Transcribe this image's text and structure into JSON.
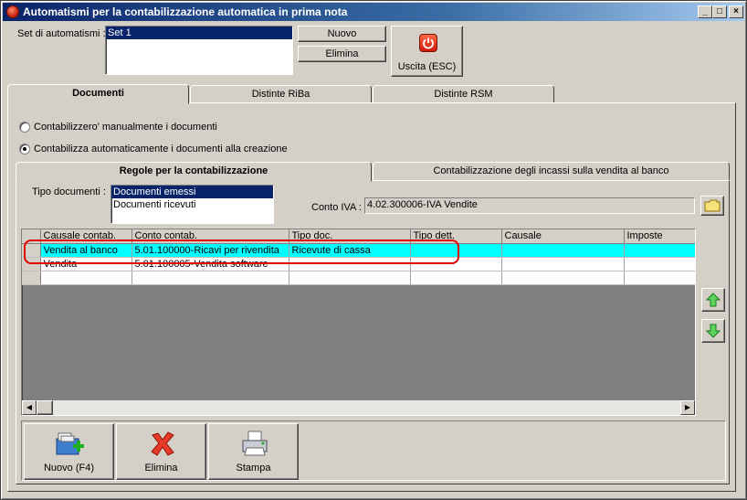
{
  "window": {
    "title": "Automatismi per la contabilizzazione automatica in prima nota",
    "controls": [
      "_",
      "□",
      "×"
    ]
  },
  "top": {
    "set_label": "Set di automatismi :",
    "sets": [
      "Set 1"
    ],
    "nuovo_label": "Nuovo",
    "elimina_label": "Elimina",
    "uscita_label": "Uscita (ESC)"
  },
  "tabs": [
    {
      "label": "Documenti",
      "active": true
    },
    {
      "label": "Distinte RiBa",
      "active": false
    },
    {
      "label": "Distinte RSM",
      "active": false
    }
  ],
  "documenti": {
    "radio_manual": "Contabilizzero' manualmente i documenti",
    "radio_auto": "Contabilizza automaticamente i documenti alla creazione",
    "selected": "auto"
  },
  "subtabs": [
    {
      "label": "Regole per la contabilizzazione",
      "active": true
    },
    {
      "label": "Contabilizzazione degli incassi sulla vendita al banco",
      "active": false
    }
  ],
  "regole": {
    "tipo_documenti_label": "Tipo documenti :",
    "tipo_documenti": [
      "Documenti emessi",
      "Documenti ricevuti"
    ],
    "conto_iva_label": "Conto IVA :",
    "conto_iva_value": "4.02.300006-IVA Vendite"
  },
  "grid": {
    "columns": [
      "Causale contab.",
      "Conto contab.",
      "Tipo doc.",
      "Tipo dett.",
      "Causale",
      "Imposte"
    ],
    "rows": [
      [
        "Vendita al banco",
        "5.01.100000-Ricavi per rivendita",
        "Ricevute di cassa",
        "",
        "",
        ""
      ],
      [
        "Vendita",
        "5.01.100005-Vendita software",
        "",
        "",
        "",
        ""
      ],
      [
        "",
        "",
        "",
        "",
        "",
        ""
      ]
    ],
    "highlight_row": 0
  },
  "bottom": {
    "nuovo_label": "Nuovo (F4)",
    "elimina_label": "Elimina",
    "stampa_label": "Stampa"
  },
  "colors": {
    "titlebar": "#0a246a",
    "selection": "#0a246a",
    "row_highlight": "#00ffff",
    "annotation": "#e00000",
    "grid_empty": "#808080"
  }
}
